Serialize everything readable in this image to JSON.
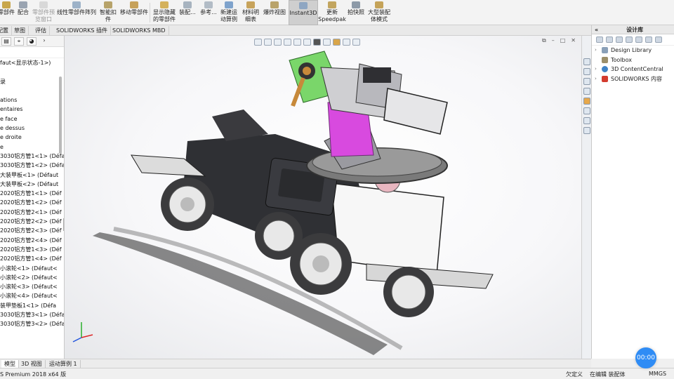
{
  "ribbon": {
    "items": [
      {
        "l1": "零部件",
        "l2": ""
      },
      {
        "l1": "配合",
        "l2": ""
      },
      {
        "l1": "零部件预",
        "l2": "览窗口"
      },
      {
        "l1": "线性零部件阵列",
        "l2": ""
      },
      {
        "l1": "智能扣",
        "l2": "件"
      },
      {
        "l1": "移动零部件",
        "l2": ""
      },
      {
        "l1": "显示隐藏",
        "l2": "的零部件"
      },
      {
        "l1": "装配...",
        "l2": ""
      },
      {
        "l1": "参考...",
        "l2": ""
      },
      {
        "l1": "新建运",
        "l2": "动算例"
      },
      {
        "l1": "材料明",
        "l2": "细表"
      },
      {
        "l1": "爆炸视图",
        "l2": ""
      },
      {
        "l1": "Instant3D",
        "l2": ""
      },
      {
        "l1": "更新",
        "l2": "Speedpak"
      },
      {
        "l1": "拍快照",
        "l2": ""
      },
      {
        "l1": "大型装配",
        "l2": "体模式"
      }
    ]
  },
  "tabs": [
    "配置",
    "草图",
    "评估",
    "SOLIDWORKS 插件",
    "SOLIDWORKS MBD"
  ],
  "feature_tree": {
    "rows": [
      "faut<显示状态-1>)",
      "",
      "录",
      "",
      "ations",
      "entaires",
      "e face",
      "e dessus",
      "e droite",
      "e",
      "3030铝方管1<1> (Défa",
      "3030铝方管1<2> (Défa",
      "大装甲板<1> (Défaut",
      "大装甲板<2> (Défaut",
      "2020铝方管1<1> (Déf",
      "2020铝方管1<2> (Déf",
      "2020铝方管2<1> (Déf",
      "2020铝方管2<2> (Déf",
      "2020铝方管2<3> (Déf",
      "2020铝方管2<4> (Déf",
      "2020铝方管1<3> (Déf",
      "2020铝方管1<4> (Déf",
      "小滚轮<1> (Défaut<",
      "小滚轮<2> (Défaut<",
      "小滚轮<3> (Défaut<",
      "小滚轮<4> (Défaut<",
      "装甲垫板1<1> (Défa",
      "3030铝方管3<1> (Défa",
      "3030铝方管3<2> (Défa"
    ]
  },
  "design_library": {
    "title": "设计库",
    "items": [
      {
        "label": "Design Library",
        "icon": "library-icon",
        "color": "#8aa0b8"
      },
      {
        "label": "Toolbox",
        "icon": "toolbox-icon",
        "color": "#9c8f6a"
      },
      {
        "label": "3D ContentCentral",
        "icon": "globe-icon",
        "color": "#3f83c6"
      },
      {
        "label": "SOLIDWORKS 内容",
        "icon": "solidworks-content-icon",
        "color": "#d33b2f"
      }
    ]
  },
  "bottom_tabs": [
    "模型",
    "3D 视图",
    "运动算例 1"
  ],
  "status": {
    "left": "S Premium 2018 x64 版",
    "underdefined": "欠定义",
    "editing": "在编辑 装配体",
    "units": "MMGS"
  },
  "timer": "00:00",
  "colors": {
    "accent": "#2f8cf5",
    "arm_green": "#7ad66a",
    "arm_magenta": "#d84adf"
  }
}
